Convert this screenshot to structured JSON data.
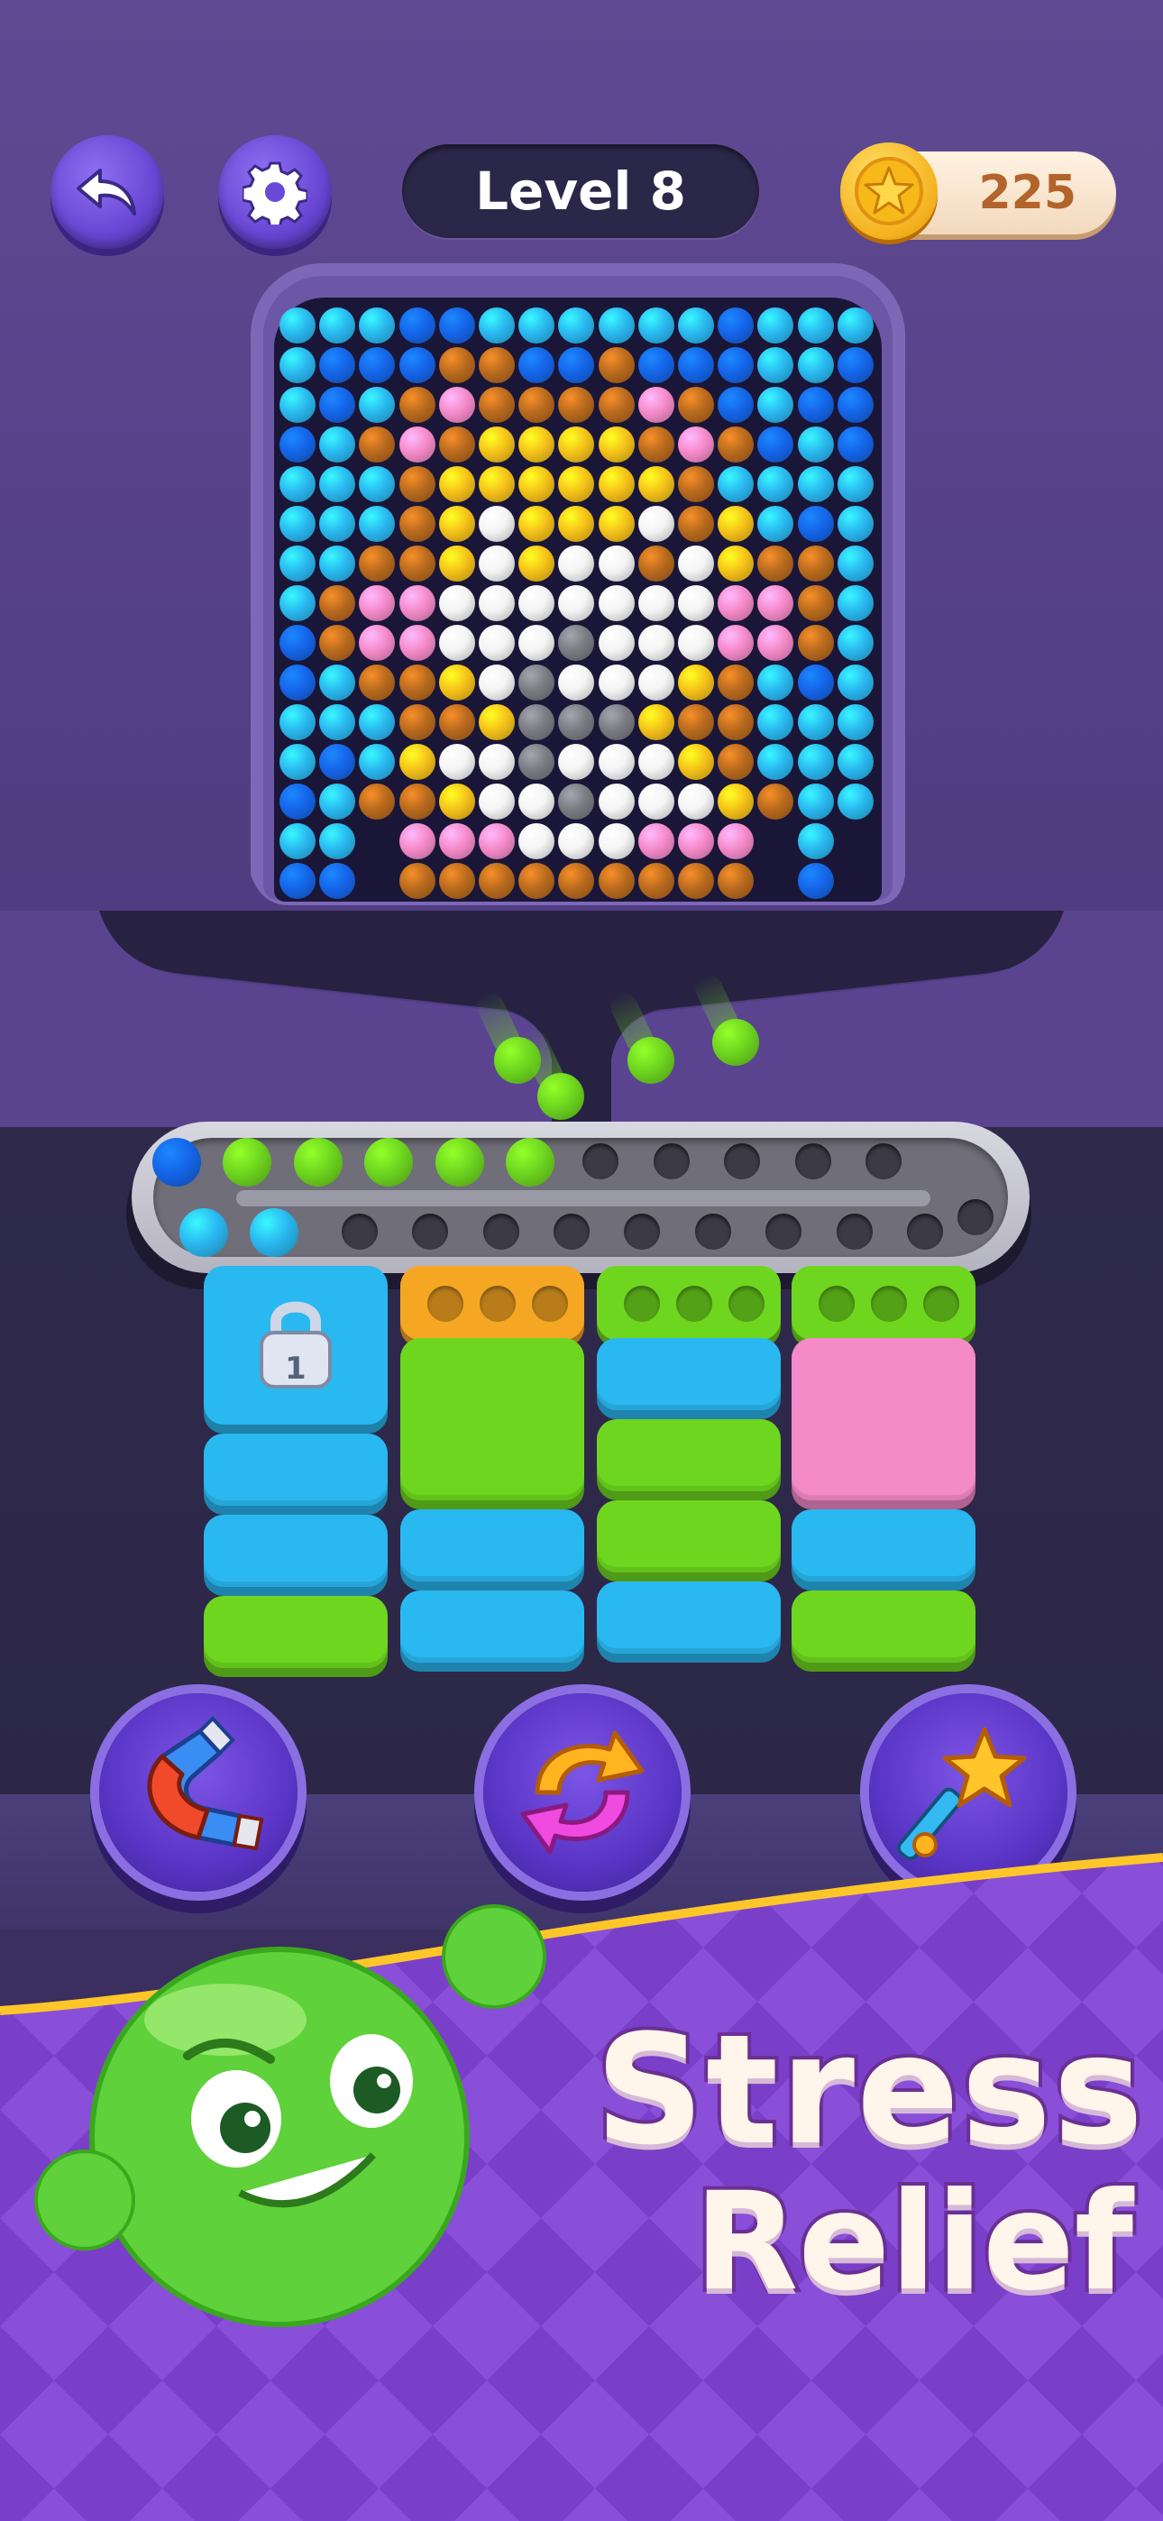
{
  "header": {
    "level_label": "Level 8",
    "coins": "225"
  },
  "icons": {
    "back": "undo-arrow-icon",
    "settings": "gear-icon",
    "coin": "star-coin-icon",
    "lock": "padlock-icon",
    "magnet": "magnet-icon",
    "shuffle": "shuffle-icon",
    "wand": "magic-wand-icon"
  },
  "colors": {
    "blue_light": "#2ab8f0",
    "blue_dark": "#1565e8",
    "brown": "#b86a1e",
    "pink": "#f58ac9",
    "yellow": "#f5c21a",
    "white": "#f4f4f4",
    "gray": "#7b7b82",
    "green": "#6ed61f",
    "orange": "#f5a623",
    "accent_purple": "#6b49d6"
  },
  "board": {
    "cols": 15,
    "rows": 15,
    "legend": {
      "B": "blue_light",
      "D": "blue_dark",
      "W": "brown",
      "P": "pink",
      "Y": "yellow",
      "H": "white",
      "G": "gray",
      ".": "empty"
    },
    "rows_data": [
      "BBBDDBBBBBBDBBB",
      "BDDDWWDDWDDDBBD",
      "BDBWPWWWWPWDBDD",
      "DBWPWYYYYWPWDBD",
      "BBBWYYYYYYWBBBB",
      "BBBWYHYYYHWYBDB",
      "BBWWYHYHHWHYWWB",
      "BWPPHHHHHHHPPWB",
      "DWPPHHHGHHHPPWB",
      "DBWWYHGHHHYWBDB",
      "BBBWWYGGGYWWBBB",
      "BDBYHHGHHHYWBBB",
      "DBWWYHHGHHHYWBB",
      "BB.PPPHHHPPP.B.",
      "DD.WWWWWWWWW.D."
    ]
  },
  "falling_balls": 4,
  "rail": {
    "top_slots": 11,
    "bottom_slots": 11,
    "top_balls": [
      "blue_dark",
      "green",
      "green",
      "green",
      "green",
      "green"
    ],
    "bottom_balls": [
      "blue_light",
      "blue_light"
    ]
  },
  "stacks": [
    {
      "locked": true,
      "lock_count": "1",
      "tiles": [
        "blue_light",
        "blue_light",
        "green"
      ]
    },
    {
      "cap": "orange",
      "tiles": [
        "green_tall",
        "blue_light",
        "blue_light"
      ]
    },
    {
      "cap": "green",
      "tiles": [
        "blue_light",
        "green",
        "green",
        "blue_light"
      ]
    },
    {
      "cap": "green",
      "tiles": [
        "pink_tall",
        "blue_light",
        "green"
      ]
    }
  ],
  "powerups": [
    "magnet",
    "shuffle",
    "wand"
  ],
  "banner": {
    "line1": "Stress",
    "line2": "Relief"
  }
}
